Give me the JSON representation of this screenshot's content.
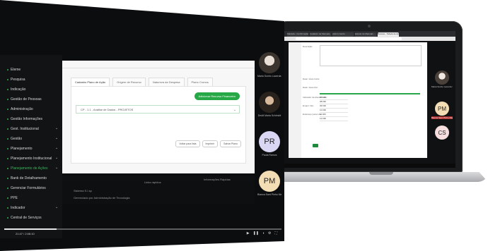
{
  "laptop": {
    "browser_tabs": [
      "Mazada - Confirmação",
      "Cadastro de Manuais",
      "Admin Cardo",
      "Estudo de Manuais",
      "Nossos - Tabela de Apoios"
    ],
    "shared_labels": [
      "Descrição:",
      "Data / Hora Início:",
      "Data / Hora Fim:",
      "Indicador de Atendimento:",
      "Email / Info:",
      "Endereço para Link:"
    ],
    "dropdown_times": [
      "07:00h",
      "08:00h",
      "09:00h",
      "10:00h",
      "11:00h",
      "12:00h"
    ],
    "participants": [
      {
        "initials": "",
        "caption": "Maria Sonho Lacerda Silva",
        "color": "#e6e1da"
      },
      {
        "initials": "PM",
        "caption": "Bianca Sant Pinho Mara",
        "color": "#f2ddb5",
        "tag": true
      },
      {
        "initials": "CS",
        "caption": "",
        "color": "#f6dede"
      }
    ]
  },
  "screen": {
    "sidebar": [
      {
        "label": "Eleme",
        "chev": false
      },
      {
        "label": "Pesquisa",
        "chev": false
      },
      {
        "label": "Indicação",
        "chev": false
      },
      {
        "label": "Gestão de Pessoas",
        "chev": false
      },
      {
        "label": "Administração",
        "chev": false
      },
      {
        "label": "Gestão Informações",
        "chev": false
      },
      {
        "label": "Gest. Institucional",
        "chev": true
      },
      {
        "label": "Gestão",
        "chev": true
      },
      {
        "label": "Planejamento",
        "chev": true
      },
      {
        "label": "Planejamento Institucional",
        "chev": true
      },
      {
        "label": "Planejamento de Ações",
        "chev": true,
        "highlight": true
      },
      {
        "label": "Bank de Detalhamento",
        "chev": false
      },
      {
        "label": "Gerenciar Formulários",
        "chev": false
      },
      {
        "label": "PPE",
        "chev": false
      },
      {
        "label": "Indicador",
        "chev": true
      },
      {
        "label": "Central de Serviços",
        "chev": false
      }
    ],
    "tabs": [
      "Cadastro Plano de Ação",
      "Origem de Recurso",
      "Natureza da Despesa",
      "Plano Cronos"
    ],
    "add_button": "Adicionar Recurso Financeiro",
    "field_value": "CP - 1.1 - Análise de Dados - PROJETOS",
    "actions": [
      "Voltar para lista",
      "Imprimir",
      "Salvar Plano"
    ],
    "footer": [
      "Sistema S.I.sp",
      "Gerenciado por Administração de Tecnologia",
      "Links rápidos",
      "Informações Rápidas"
    ],
    "participants": [
      {
        "initials": "",
        "caption": "Maria Sonho Lacerda Silva",
        "photo": 1
      },
      {
        "initials": "",
        "caption": "Dedã Maria Schimidt",
        "photo": 2
      },
      {
        "initials": "PR",
        "caption": "Paula Ramos",
        "color": "#d8d6f2"
      },
      {
        "initials": "PM",
        "caption": "Bianca Sant Pinho Mara",
        "color": "#f2ddb5"
      }
    ],
    "time": "21:47 / 2:06:10",
    "progress": 0.19,
    "controls": [
      "play-icon",
      "pause-icon",
      "volume-icon",
      "settings-icon",
      "fullscreen-icon"
    ]
  }
}
